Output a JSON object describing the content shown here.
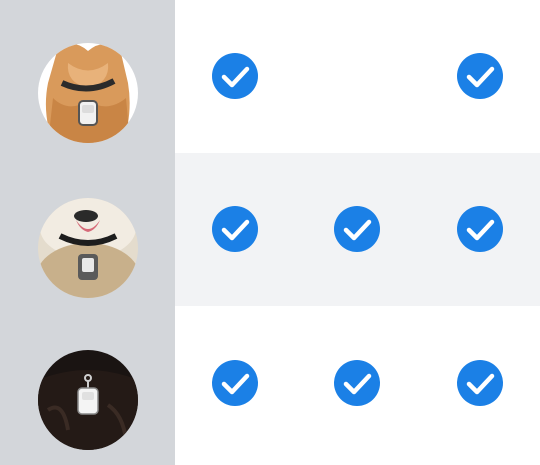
{
  "colors": {
    "check_fill": "#1b80e6",
    "left_column": "#d3d6da",
    "alt_row": "#f2f3f5"
  },
  "rows": [
    {
      "pet": "cat",
      "icon": "cat-with-tag-photo",
      "checks": [
        true,
        false,
        true
      ]
    },
    {
      "pet": "small-dog",
      "icon": "small-dog-with-tag-photo",
      "checks": [
        true,
        true,
        true
      ]
    },
    {
      "pet": "black-dog",
      "icon": "black-dog-with-tag-photo",
      "checks": [
        true,
        true,
        true
      ]
    }
  ]
}
